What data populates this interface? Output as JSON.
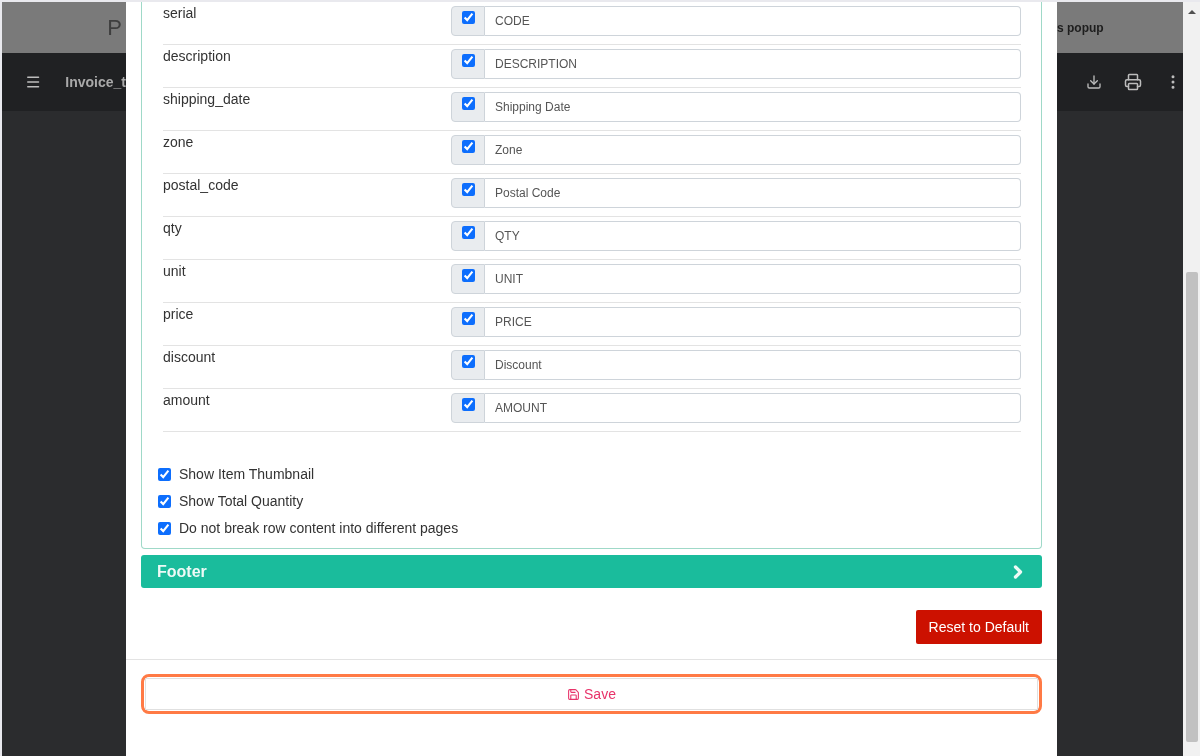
{
  "background": {
    "header_left": "P",
    "header_right": "s popup",
    "document_title": "Invoice_t"
  },
  "fields": [
    {
      "name": "serial",
      "enabled": true,
      "value": "CODE"
    },
    {
      "name": "description",
      "enabled": true,
      "value": "DESCRIPTION"
    },
    {
      "name": "shipping_date",
      "enabled": true,
      "value": "Shipping Date"
    },
    {
      "name": "zone",
      "enabled": true,
      "value": "Zone"
    },
    {
      "name": "postal_code",
      "enabled": true,
      "value": "Postal Code"
    },
    {
      "name": "qty",
      "enabled": true,
      "value": "QTY"
    },
    {
      "name": "unit",
      "enabled": true,
      "value": "UNIT"
    },
    {
      "name": "price",
      "enabled": true,
      "value": "PRICE"
    },
    {
      "name": "discount",
      "enabled": true,
      "value": "Discount"
    },
    {
      "name": "amount",
      "enabled": true,
      "value": "AMOUNT"
    }
  ],
  "options": [
    {
      "label": "Show Item Thumbnail",
      "checked": true
    },
    {
      "label": "Show Total Quantity",
      "checked": true
    },
    {
      "label": "Do not break row content into different pages",
      "checked": true
    }
  ],
  "footer_section": {
    "title": "Footer",
    "expanded": false
  },
  "reset_button": "Reset to Default",
  "save_button": "Save"
}
